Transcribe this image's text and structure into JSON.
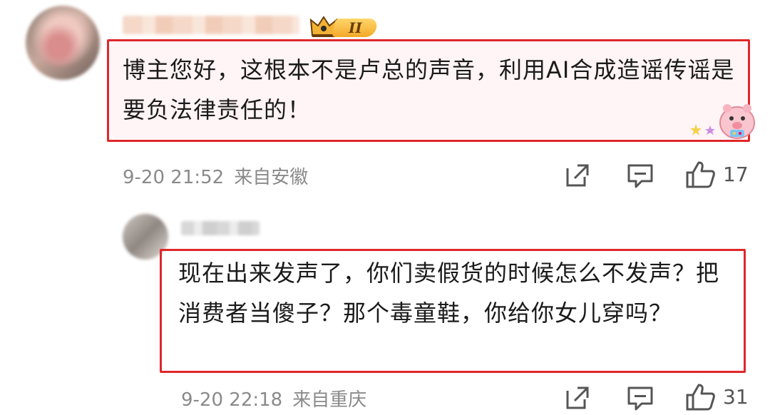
{
  "comments": [
    {
      "text": "博主您好，这根本不是卢总的声音，利用AI合成造谣传谣是要负法律责任的！",
      "date": "9-20 21:52",
      "location": "来自安徽",
      "like_count": "17",
      "badge": "II"
    },
    {
      "text": "现在出来发声了，你们卖假货的时候怎么不发声？把消费者当傻子？那个毒童鞋，你给你女儿穿吗？",
      "date": "9-20 22:18",
      "location": "来自重庆",
      "like_count": "31"
    }
  ],
  "icons": {
    "share": "share-icon",
    "comment": "comment-icon",
    "like": "thumbs-up-icon",
    "crown": "crown-icon",
    "sticker": "pig-sticker-icon"
  },
  "colors": {
    "highlight_frame": "#e0262a",
    "bubble_bg": "#fff4f6",
    "meta_text": "#8a8a8a"
  }
}
